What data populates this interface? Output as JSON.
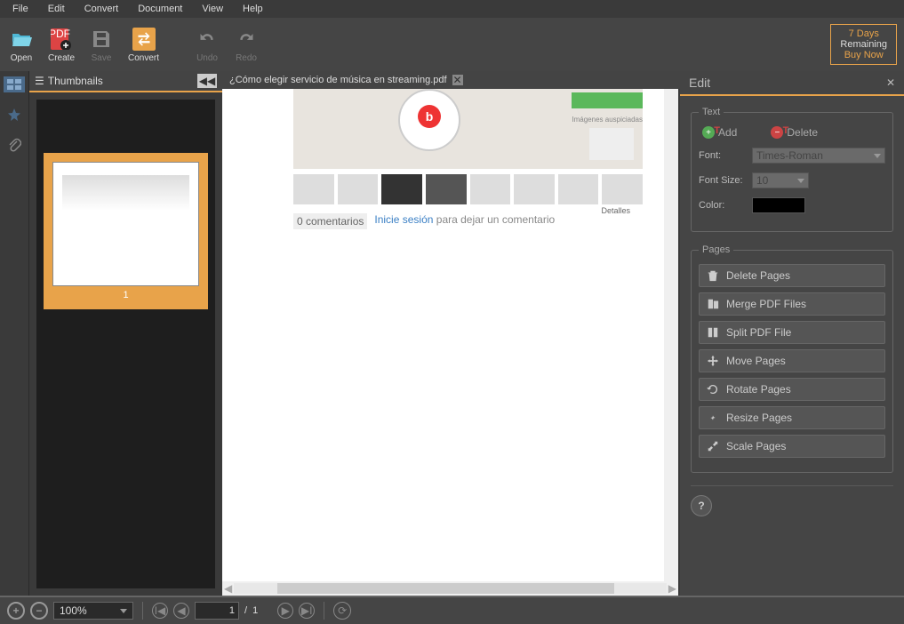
{
  "menu": [
    "File",
    "Edit",
    "Convert",
    "Document",
    "View",
    "Help"
  ],
  "toolbar": {
    "open": "Open",
    "create": "Create",
    "save": "Save",
    "convert": "Convert",
    "undo": "Undo",
    "redo": "Redo"
  },
  "trial": {
    "days": "7 Days",
    "remaining": "Remaining",
    "buy": "Buy Now"
  },
  "thumbnails": {
    "title": "Thumbnails",
    "page_num": "1"
  },
  "doc": {
    "tab_title": "¿Cómo elegir servicio de música en streaming.pdf",
    "auspiciadas": "Imágenes auspiciadas",
    "comments_count": "0 comentarios",
    "inicie": "Inicie sesión",
    "para": "para dejar un comentario",
    "detalles": "Detalles",
    "beats": "b"
  },
  "edit": {
    "title": "Edit",
    "text_legend": "Text",
    "add": "Add",
    "delete": "Delete",
    "font_label": "Font:",
    "font_value": "Times-Roman",
    "fontsize_label": "Font Size:",
    "fontsize_value": "10",
    "color_label": "Color:",
    "pages_legend": "Pages",
    "delete_pages": "Delete Pages",
    "merge": "Merge PDF Files",
    "split": "Split PDF File",
    "move": "Move Pages",
    "rotate": "Rotate Pages",
    "resize": "Resize Pages",
    "scale": "Scale Pages",
    "help": "?"
  },
  "bottom": {
    "zoom": "100%",
    "page_current": "1",
    "page_sep": "/",
    "page_total": "1"
  }
}
